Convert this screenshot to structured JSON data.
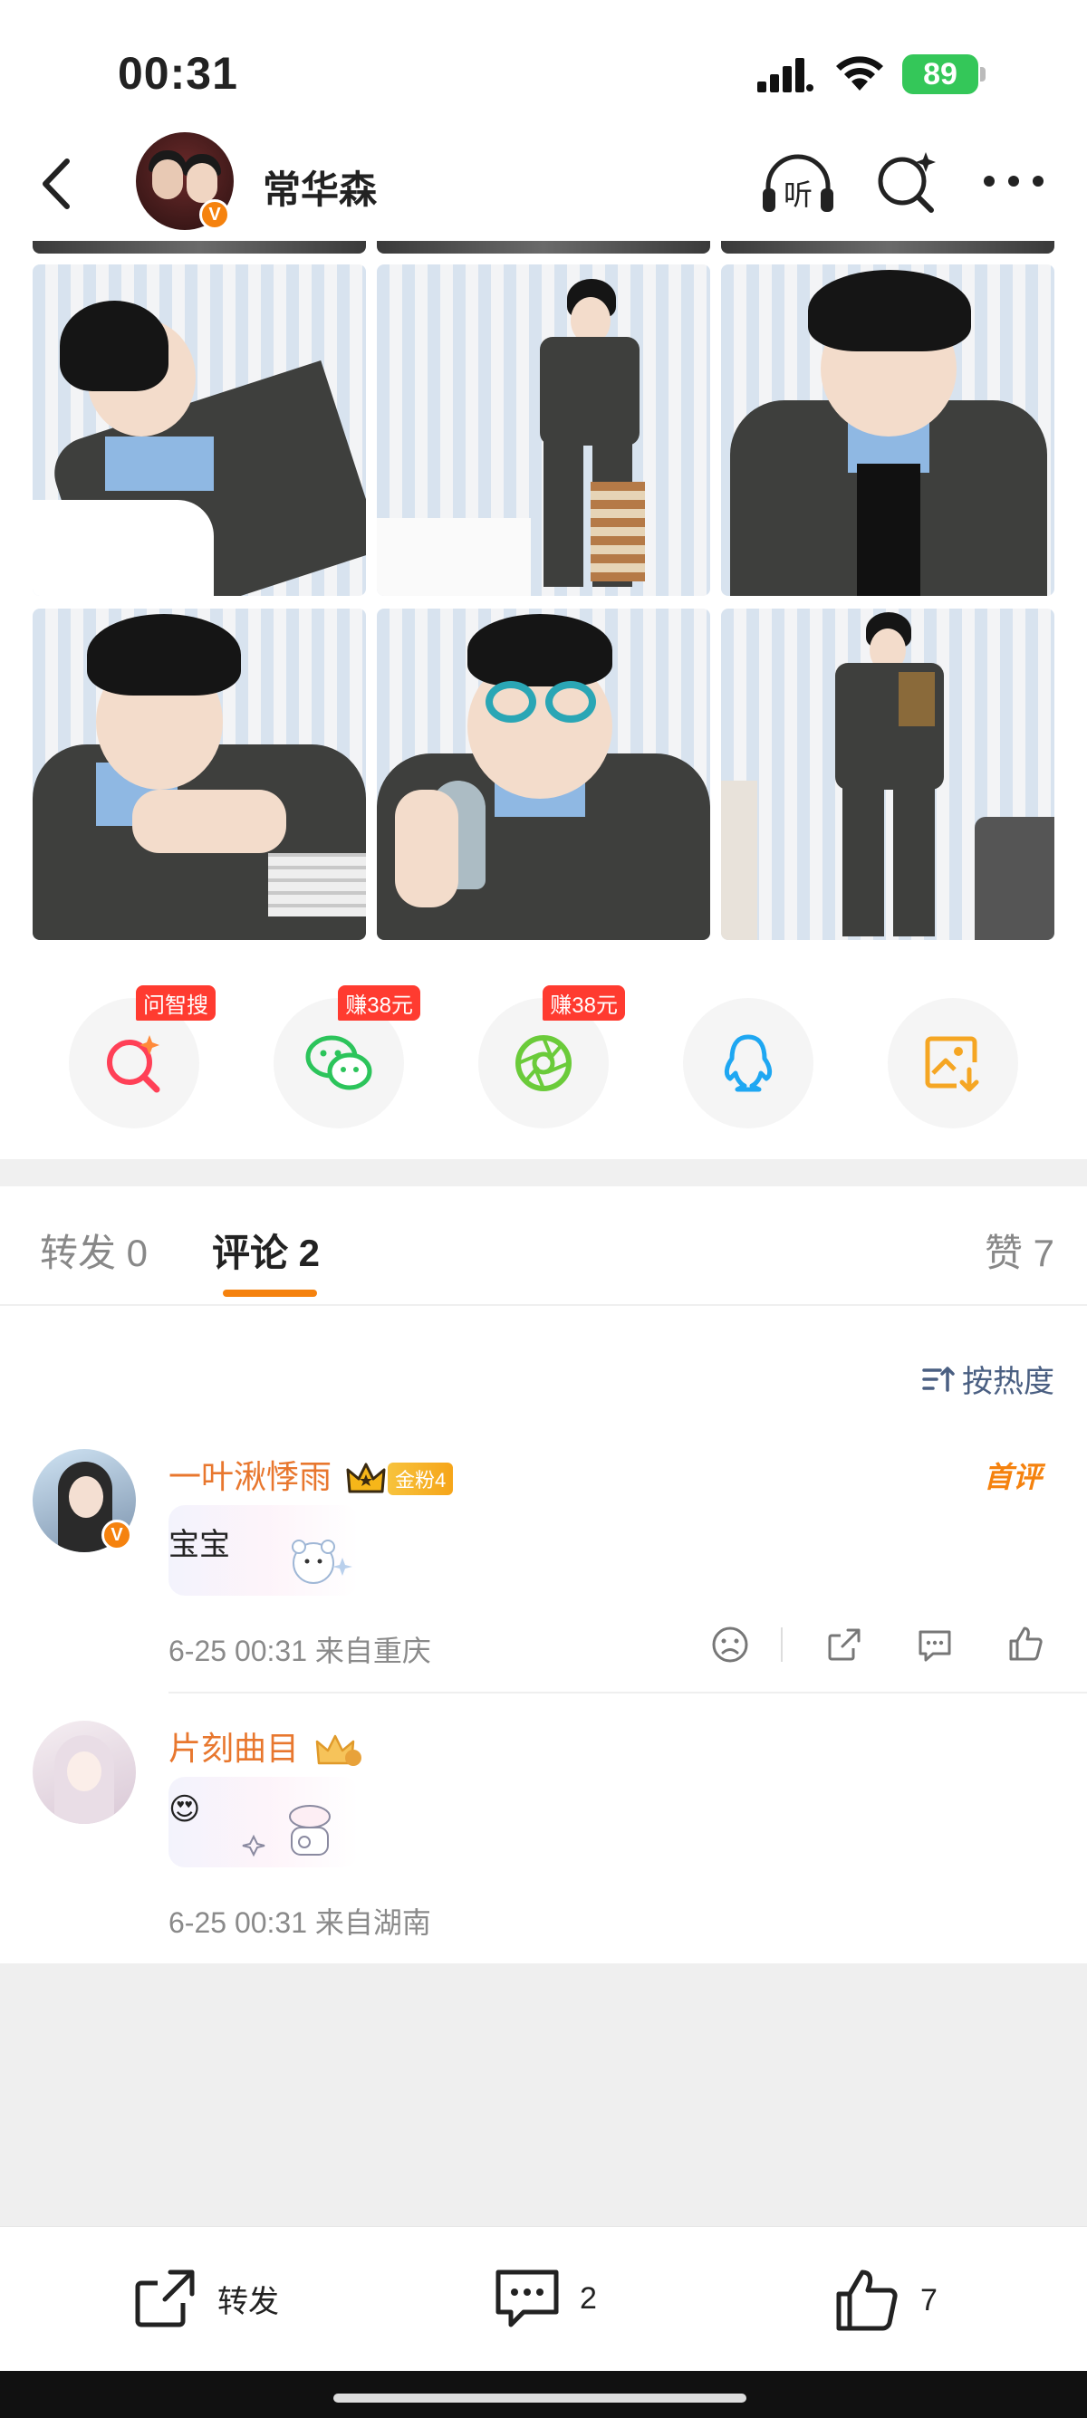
{
  "status_bar": {
    "time": "00:31",
    "battery": "89"
  },
  "header": {
    "title": "常华森",
    "listen_label": "听"
  },
  "share": [
    {
      "name": "ai-search",
      "tag": "问智搜",
      "color": "#ff4057"
    },
    {
      "name": "wechat",
      "tag": "赚38元",
      "color": "#2cc45b"
    },
    {
      "name": "moments",
      "tag": "赚38元",
      "color": "#6bcb3a"
    },
    {
      "name": "qq",
      "tag": "",
      "color": "#1ea7f2"
    },
    {
      "name": "save-image",
      "tag": "",
      "color": "#f5a623"
    }
  ],
  "tabs": {
    "repost": "转发 0",
    "comments": "评论 2",
    "likes": "赞 7"
  },
  "sort_label": "按热度",
  "comments": [
    {
      "user": "一叶湫悸雨",
      "fan_badge": "金粉4",
      "first_tag": "首评",
      "text": "宝宝",
      "meta": "6-25 00:31  来自重庆"
    },
    {
      "user": "片刻曲目",
      "text": "😍",
      "meta": "6-25 00:31  来自湖南"
    }
  ],
  "toolbar": {
    "repost": "转发",
    "comment_count": "2",
    "like_count": "7"
  }
}
